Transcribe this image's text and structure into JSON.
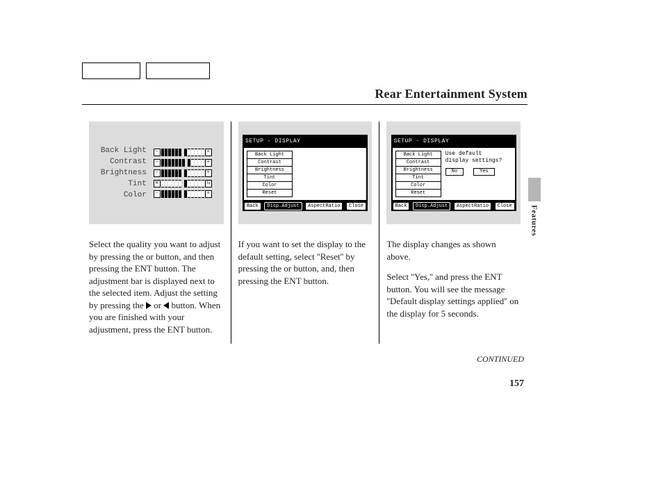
{
  "header": {
    "title": "Rear Entertainment System"
  },
  "side_tab": "Features",
  "continued": "CONTINUED",
  "page_number": "157",
  "col1": {
    "labels": [
      "Back Light",
      "Contrast",
      "Brightness",
      "Tint",
      "Color"
    ],
    "slider_left": "−",
    "slider_right": "+",
    "tint_left": "R",
    "tint_right": "G",
    "paragraph_a": "Select the quality you want to adjust by pressing the ",
    "paragraph_b": " or ",
    "paragraph_c": " button, and then pressing the ENT button. The adjustment bar is displayed next to the selected item. Adjust the setting by pressing the  ",
    "paragraph_d": "  or  ",
    "paragraph_e": "  button. When you are finished with your adjustment, press the ENT button."
  },
  "col2": {
    "setup_title": "SETUP - DISPLAY",
    "menu": [
      "Back Light",
      "Contrast",
      "Brightness",
      "Tint",
      "Color",
      "Reset"
    ],
    "footer": {
      "back": "Back",
      "disp": "Disp.Adjust",
      "aspect": "AspectRatio",
      "close": "Close"
    },
    "paragraph": "If you want to set the display to the default setting, select ''Reset'' by pressing the      or      button, and, then pressing the ENT button."
  },
  "col3": {
    "setup_title": "SETUP - DISPLAY",
    "menu": [
      "Back Light",
      "Contrast",
      "Brightness",
      "Tint",
      "Color",
      "Reset"
    ],
    "prompt_line1": "Use default",
    "prompt_line2": "display settings?",
    "btn_no": "No",
    "btn_yes": "Yes",
    "footer": {
      "back": "Back",
      "disp": "Disp.Adjust",
      "aspect": "AspectRatio",
      "close": "Close"
    },
    "paragraph1": "The display changes as shown above.",
    "paragraph2": "Select ''Yes,'' and press the ENT button. You will see the message ''Default display settings applied'' on the display for 5 seconds."
  }
}
